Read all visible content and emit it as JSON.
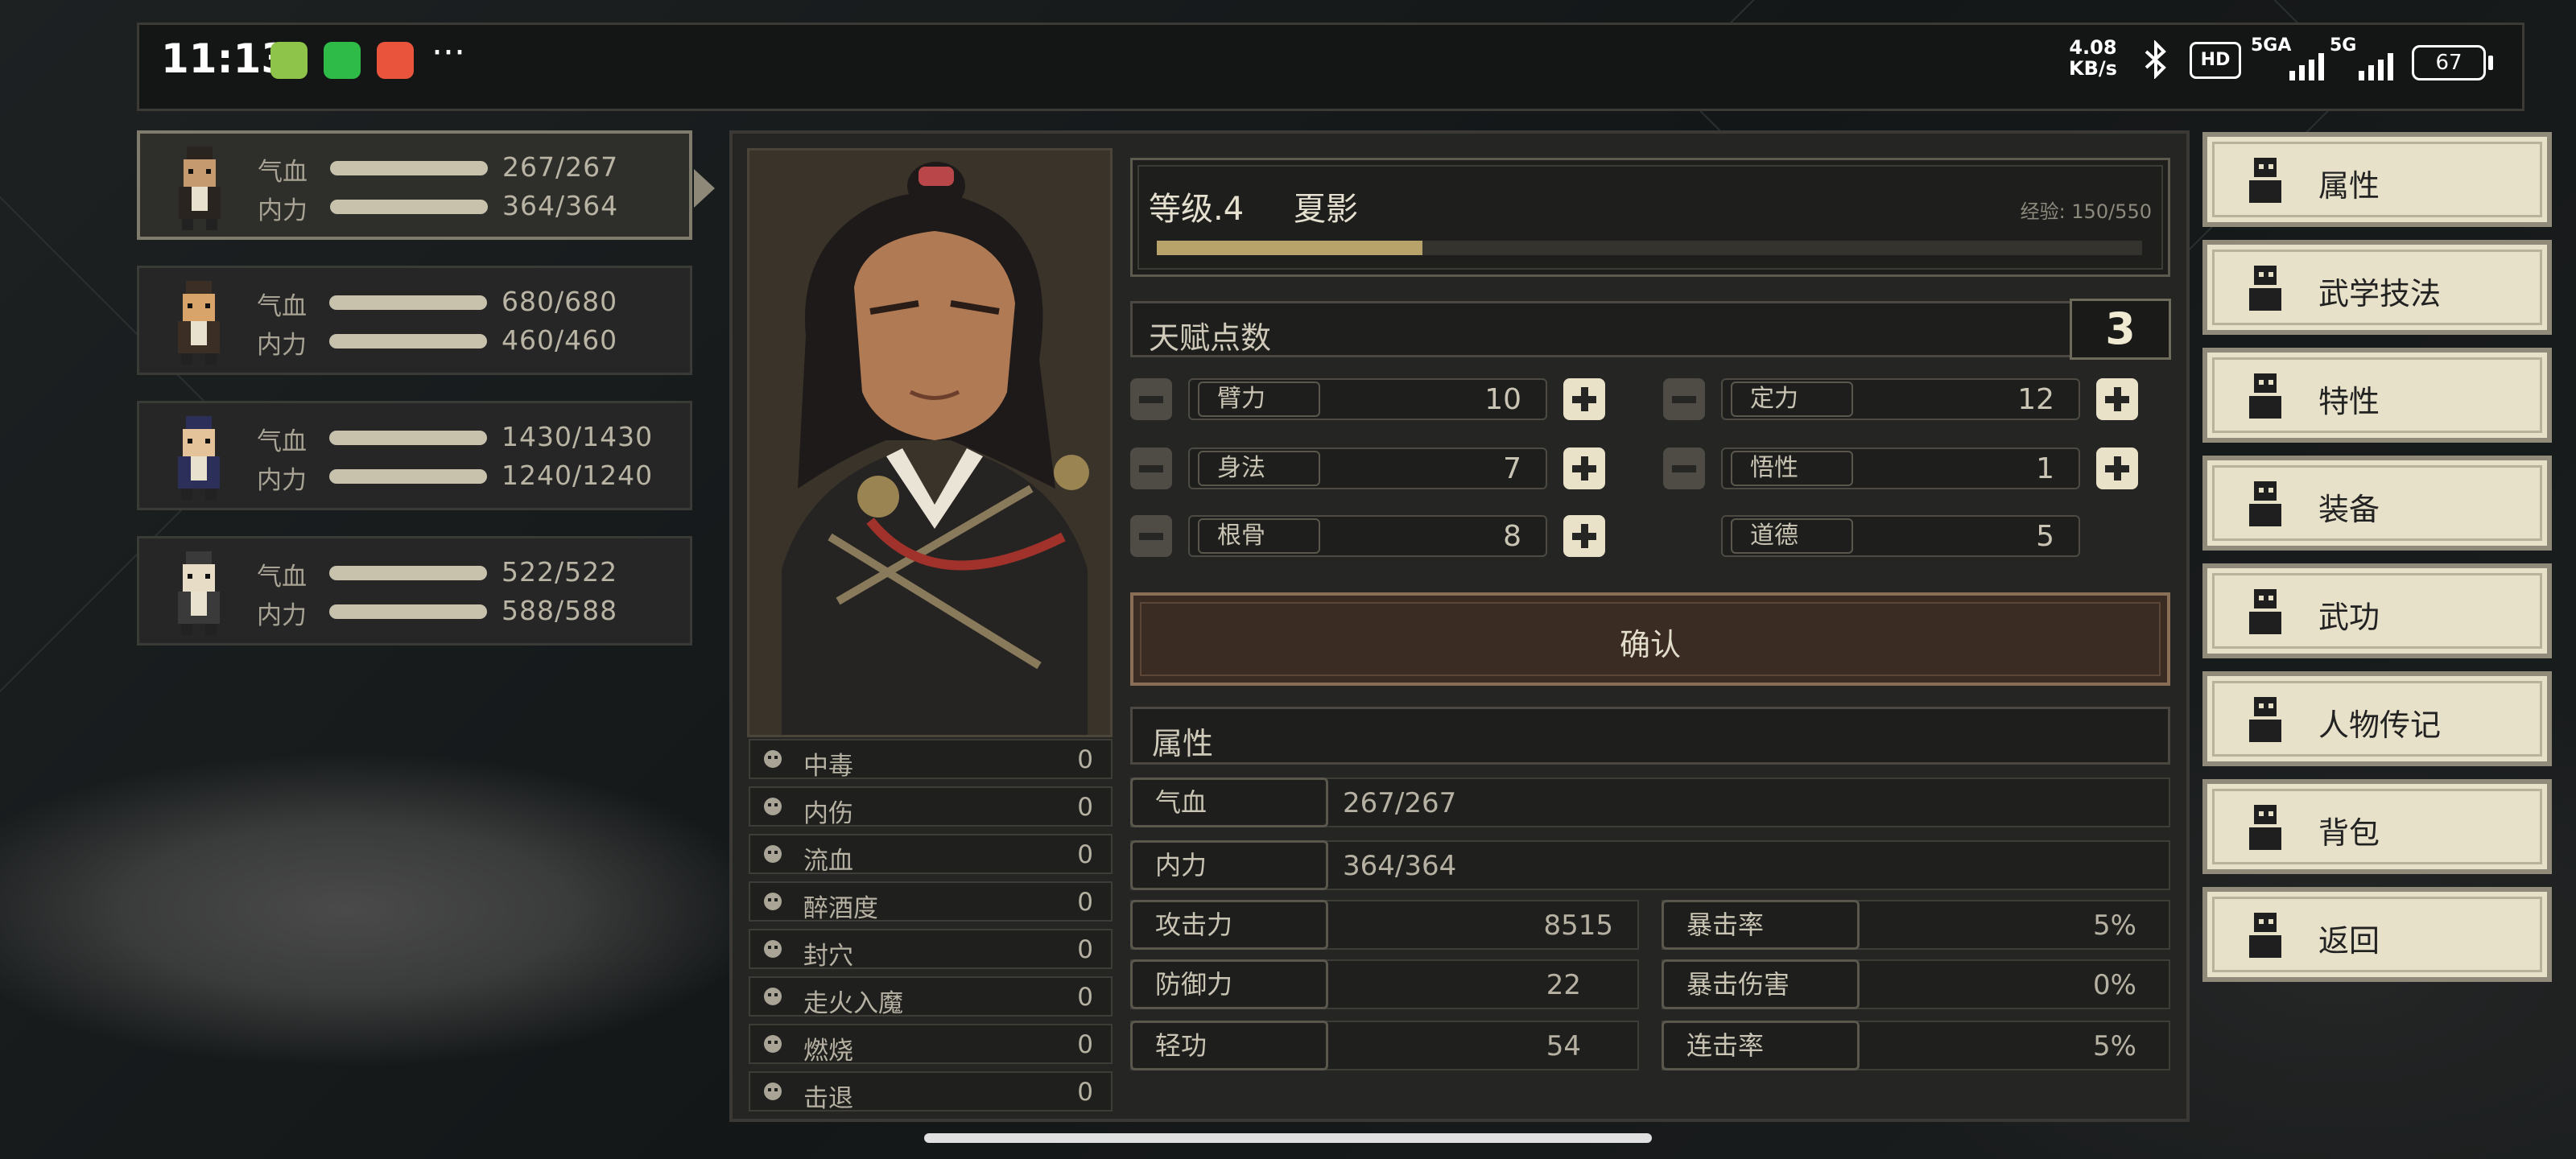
{
  "status_bar": {
    "time": "11:13",
    "more": "···",
    "net_speed": "4.08",
    "net_unit": "KB/s",
    "hd": "HD",
    "sig1": "5GA",
    "sig2": "5G",
    "battery": "67"
  },
  "party": [
    {
      "hp_label": "气血",
      "hp": "267/267",
      "mp_label": "内力",
      "mp": "364/364",
      "active": true
    },
    {
      "hp_label": "气血",
      "hp": "680/680",
      "mp_label": "内力",
      "mp": "460/460",
      "active": false
    },
    {
      "hp_label": "气血",
      "hp": "1430/1430",
      "mp_label": "内力",
      "mp": "1240/1240",
      "active": false
    },
    {
      "hp_label": "气血",
      "hp": "522/522",
      "mp_label": "内力",
      "mp": "588/588",
      "active": false
    }
  ],
  "character": {
    "level_label": "等级.4",
    "name": "夏影",
    "exp_text": "经验: 150/550",
    "exp_fraction": 0.27,
    "talent_label": "天赋点数",
    "talent_points": "3"
  },
  "attributes": [
    {
      "label": "臂力",
      "value": "10"
    },
    {
      "label": "定力",
      "value": "12"
    },
    {
      "label": "身法",
      "value": "7"
    },
    {
      "label": "悟性",
      "value": "1"
    },
    {
      "label": "根骨",
      "value": "8"
    },
    {
      "label": "道德",
      "value": "5"
    }
  ],
  "confirm_label": "确认",
  "section_title": "属性",
  "stats": {
    "hp": {
      "label": "气血",
      "value": "267/267"
    },
    "mp": {
      "label": "内力",
      "value": "364/364"
    },
    "attack": {
      "label": "攻击力",
      "value": "8515"
    },
    "crit_rate": {
      "label": "暴击率",
      "value": "5%"
    },
    "defense": {
      "label": "防御力",
      "value": "22"
    },
    "crit_dmg": {
      "label": "暴击伤害",
      "value": "0%"
    },
    "agility": {
      "label": "轻功",
      "value": "54"
    },
    "combo": {
      "label": "连击率",
      "value": "5%"
    }
  },
  "status_effects": [
    {
      "name": "中毒",
      "value": "0",
      "icon": "skull-icon"
    },
    {
      "name": "内伤",
      "value": "0",
      "icon": "broken-heart-icon"
    },
    {
      "name": "流血",
      "value": "0",
      "icon": "blood-icon"
    },
    {
      "name": "醉酒度",
      "value": "0",
      "icon": "drunk-icon"
    },
    {
      "name": "封穴",
      "value": "0",
      "icon": "acupoint-icon"
    },
    {
      "name": "走火入魔",
      "value": "0",
      "icon": "demon-icon"
    },
    {
      "name": "燃烧",
      "value": "0",
      "icon": "fire-icon"
    },
    {
      "name": "击退",
      "value": "0",
      "icon": "boot-icon"
    }
  ],
  "menu": [
    {
      "label": "属性",
      "icon": "character-icon"
    },
    {
      "label": "武学技法",
      "icon": "skill-tree-icon"
    },
    {
      "label": "特性",
      "icon": "trait-icon"
    },
    {
      "label": "装备",
      "icon": "sword-icon"
    },
    {
      "label": "武功",
      "icon": "book-icon"
    },
    {
      "label": "人物传记",
      "icon": "scroll-icon"
    },
    {
      "label": "背包",
      "icon": "bag-icon"
    },
    {
      "label": "返回",
      "icon": "door-icon"
    }
  ],
  "colors": {
    "panel": "#252523",
    "menu_bg": "#e8e1c9",
    "confirm_bg": "#3a2c22",
    "exp_fill": "#b8a46b"
  }
}
